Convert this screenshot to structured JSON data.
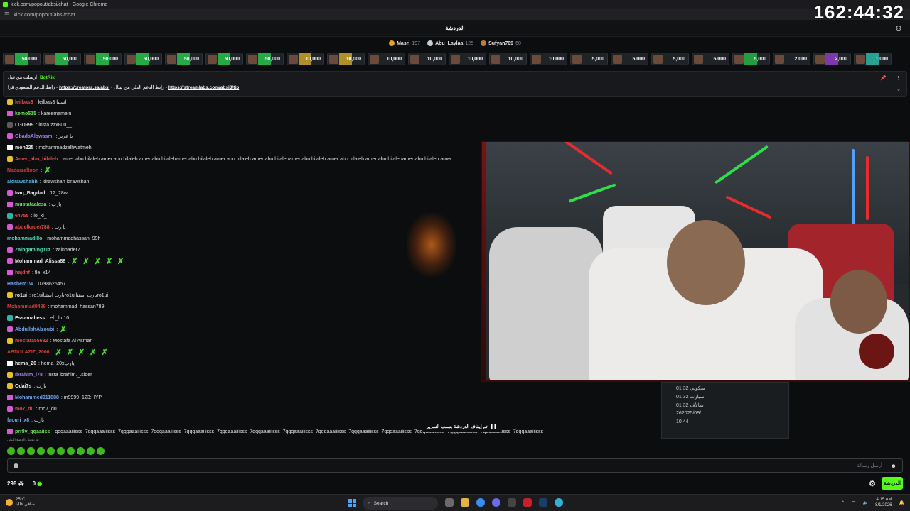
{
  "window": {
    "title": "kick.com/popout/absi/chat - Google Chrome",
    "url": "kick.com/popout/absi/chat"
  },
  "timer": "162:44:32",
  "header": {
    "title": "الدردشة"
  },
  "leaders": [
    {
      "name": "Masri",
      "points": "197",
      "color": "#e0a326"
    },
    {
      "name": "Abu_Laylaa",
      "points": "125",
      "color": "#c8cdd2"
    },
    {
      "name": "Sufyan709",
      "points": "60",
      "color": "#c07a3c"
    }
  ],
  "gifts": [
    {
      "amount": "50,000",
      "color": "#27c24c"
    },
    {
      "amount": "50,000",
      "color": "#27c24c"
    },
    {
      "amount": "50,000",
      "color": "#27c24c"
    },
    {
      "amount": "50,000",
      "color": "#27c24c"
    },
    {
      "amount": "50,000",
      "color": "#27c24c"
    },
    {
      "amount": "50,000",
      "color": "#27c24c"
    },
    {
      "amount": "50,000",
      "color": "#27c24c"
    },
    {
      "amount": "10,000",
      "color": "#c9a227"
    },
    {
      "amount": "10,000",
      "color": "#c9a227"
    },
    {
      "amount": "10,000",
      "color": "#1f2327"
    },
    {
      "amount": "10,000",
      "color": "#1f2327"
    },
    {
      "amount": "10,000",
      "color": "#1f2327"
    },
    {
      "amount": "10,000",
      "color": "#1f2327"
    },
    {
      "amount": "10,000",
      "color": "#1f2327"
    },
    {
      "amount": "5,000",
      "color": "#1f2327"
    },
    {
      "amount": "5,000",
      "color": "#1f2327"
    },
    {
      "amount": "5,000",
      "color": "#1f2327"
    },
    {
      "amount": "5,000",
      "color": "#1f2327"
    },
    {
      "amount": "5,000",
      "color": "#26b24a"
    },
    {
      "amount": "2,000",
      "color": "#1f2327"
    },
    {
      "amount": "2,000",
      "color": "#8e3cc7"
    },
    {
      "amount": "1,000",
      "color": "#2bb6a8"
    }
  ],
  "pinned": {
    "pinned_by": "أرسلت من قبل",
    "bot": "BotRix",
    "text_a": "رابط الدعم السعودي قزا - ",
    "link_a": "https://creators.sa/absi",
    "text_b": " - رابط الدعم الدلي من بيبال - ",
    "link_b": "https://streamlabs.com/absi3/tip"
  },
  "messages": [
    {
      "user": "leilbas3",
      "text": ": leilbas3 استنا",
      "color": "#e14b4b",
      "badge": "#e6c229"
    },
    {
      "user": "kemo515",
      "text": ": kareemamein",
      "color": "#6ce05a",
      "badge": "#d45bd0"
    },
    {
      "user": "LGD999",
      "text": ": insta zzx800__",
      "color": "#c9c9c9",
      "badge": "#5c5c5c"
    },
    {
      "user": "ObadaAlqwasmi",
      "text": ": يا عزيز",
      "color": "#a77ee8",
      "badge": "#d45bd0"
    },
    {
      "user": "moh225",
      "text": ": mohammadzalhwatmeh",
      "color": "#e8e8e8",
      "badge": "#ffffff"
    },
    {
      "user": "Amer_abu_hilaleh",
      "text": ": amer abu hilaleh amer abu hilaleh amer abu hilalehamer abu hilaleh amer abu hilaleh amer abu hilalehamer abu hilaleh amer abu hilaleh amer abu hilalehamer abu hilaleh amer",
      "color": "#e14b4b",
      "badge": "#e6c229"
    },
    {
      "user": "Nadarzaltoon",
      "text": ":",
      "color": "#d03a3a",
      "badge": "",
      "emotes": 1
    },
    {
      "user": "aldrawshahh",
      "text": ": idrawshah idrawshah",
      "color": "#4fb6e8",
      "badge": ""
    },
    {
      "user": "Iraq_Bagdad",
      "text": ": 12_28w",
      "color": "#e8e8e8",
      "badge": "#d45bd0"
    },
    {
      "user": "mustafaalesa",
      "text": ": يارب",
      "color": "#6ce05a",
      "badge": "#d45bd0"
    },
    {
      "user": "64755",
      "text": ": io_xl_",
      "color": "#e14b4b",
      "badge": "#2bb6a8"
    },
    {
      "user": "abdelkader788",
      "text": ": يا رب",
      "color": "#e14b4b",
      "badge": "#d45bd0"
    },
    {
      "user": "mohammadillo",
      "text": ": mohammadhassan_99h",
      "color": "#4fdfb8",
      "badge": ""
    },
    {
      "user": "Zaingaming11z",
      "text": ": zainbader7",
      "color": "#4fdfb8",
      "badge": "#d45bd0"
    },
    {
      "user": "Mohammad_Alissa88",
      "text": ":",
      "color": "#e8e8e8",
      "badge": "#d45bd0",
      "emotes": 5
    },
    {
      "user": "hajdnf",
      "text": ": fle_x14",
      "color": "#e14b4b",
      "badge": "#d45bd0"
    },
    {
      "user": "Hashem1w",
      "text": ": 0798625457",
      "color": "#6fa5f0",
      "badge": ""
    },
    {
      "user": "ro1ui",
      "text": ": ro1uiيارب استناro1uiيارب استناro1ui",
      "color": "#e8e8e8",
      "badge": "#e6c229"
    },
    {
      "user": "Mohammad9489",
      "text": ": mohammad_hassan789",
      "color": "#d03a3a",
      "badge": ""
    },
    {
      "user": "Essamahess",
      "text": ": ef._lm10",
      "color": "#e8e8e8",
      "badge": "#2bb6a8"
    },
    {
      "user": "AbdullahAlzoubi",
      "text": ":",
      "color": "#6fa5f0",
      "badge": "#d45bd0",
      "emotes": 1
    },
    {
      "user": "mostafa55682",
      "text": ": Mostafa Al Asmar",
      "color": "#e14b4b",
      "badge": "#e6c229"
    },
    {
      "user": "ABDULAZIZ_2006",
      "text": ":",
      "color": "#d03a3a",
      "badge": "",
      "emotes": 5
    },
    {
      "user": "hema_20",
      "text": ": hema_20xيارب",
      "color": "#e8e8e8",
      "badge": "#ffffff"
    },
    {
      "user": "Ibrahim_i78",
      "text": ": insta ibrahim._.sider",
      "color": "#a77ee8",
      "badge": "#e6c229"
    },
    {
      "user": "Odai7s",
      "text": ": يارب",
      "color": "#e8e8e8",
      "badge": "#e6c229"
    },
    {
      "user": "Mohammed911888",
      "text": ": m9999_123:HYP",
      "color": "#6fa5f0",
      "badge": "#d45bd0"
    },
    {
      "user": "mo7_d0",
      "text": ": mo7_d0",
      "color": "#e14b4b",
      "badge": "#d45bd0"
    },
    {
      "user": "faouri_x8",
      "text": ": يارب",
      "color": "#6fa5f0",
      "badge": ""
    },
    {
      "user": "prr8v_qqaaiiss",
      "text": ": qqqaaaiiisss_7qqqaaaiiisss_7qqqaaaiiisss_7qqqaaaiiisss_7qqqaaaiiisss_7qqqaaaiiisss_7qqqaaaiiisss_7qqqaaaiiisss_7qqqaaaiiisss_7qqqaaaiiisss_7qqqaaaiiisss_7qqqaaaiiisss_7qqqaaaiiisss_7qqqaaaiiisss_7qqqaaaiiisss",
      "color": "#6ce05a",
      "badge": "#d45bd0"
    }
  ],
  "overlay_list": [
    "سكوني 01:32",
    "سيازت 01:32",
    "سالأف 01:32",
    "262025/09/",
    "10:44"
  ],
  "paused_text": "تم إيقاف الدردشة بسبب التمرير",
  "emote_tray_label": "تم تفعيل الوضع الليلي",
  "input": {
    "placeholder": "أرسل رسالة"
  },
  "bottom": {
    "viewers": "298",
    "zero": "0",
    "chat_button": "الدردشة"
  },
  "taskbar": {
    "temp": "25°C",
    "condition": "صافي غالبا",
    "search": "Search",
    "time": "4:15 AM",
    "date": "8/1/2026"
  }
}
